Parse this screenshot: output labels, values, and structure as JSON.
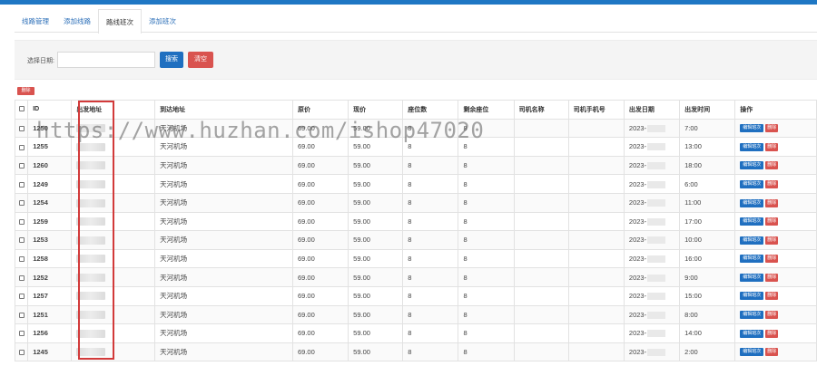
{
  "tabs": [
    {
      "label": "线路管理"
    },
    {
      "label": "添加线路"
    },
    {
      "label": "路线班次"
    },
    {
      "label": "添加班次"
    }
  ],
  "filter": {
    "label": "选择日期:",
    "input_value": "",
    "search_label": "搜索",
    "clear_label": "清空"
  },
  "bulk_delete_label": "删除",
  "table": {
    "headers": [
      "ID",
      "出发地址",
      "到达地址",
      "原价",
      "现价",
      "座位数",
      "剩余座位",
      "司机名称",
      "司机手机号",
      "出发日期",
      "出发时间",
      "操作"
    ],
    "rows": [
      {
        "id": "1250",
        "to": "天河机场",
        "op": "69.00",
        "np": "59.00",
        "seat": "8",
        "rem": "8",
        "date": "2023-",
        "time": "7:00"
      },
      {
        "id": "1255",
        "to": "天河机场",
        "op": "69.00",
        "np": "59.00",
        "seat": "8",
        "rem": "8",
        "date": "2023-",
        "time": "13:00"
      },
      {
        "id": "1260",
        "to": "天河机场",
        "op": "69.00",
        "np": "59.00",
        "seat": "8",
        "rem": "8",
        "date": "2023-",
        "time": "18:00"
      },
      {
        "id": "1249",
        "to": "天河机场",
        "op": "69.00",
        "np": "59.00",
        "seat": "8",
        "rem": "8",
        "date": "2023-",
        "time": "6:00"
      },
      {
        "id": "1254",
        "to": "天河机场",
        "op": "69.00",
        "np": "59.00",
        "seat": "8",
        "rem": "8",
        "date": "2023-",
        "time": "11:00"
      },
      {
        "id": "1259",
        "to": "天河机场",
        "op": "69.00",
        "np": "59.00",
        "seat": "8",
        "rem": "8",
        "date": "2023-",
        "time": "17:00"
      },
      {
        "id": "1253",
        "to": "天河机场",
        "op": "69.00",
        "np": "59.00",
        "seat": "8",
        "rem": "8",
        "date": "2023-",
        "time": "10:00"
      },
      {
        "id": "1258",
        "to": "天河机场",
        "op": "69.00",
        "np": "59.00",
        "seat": "8",
        "rem": "8",
        "date": "2023-",
        "time": "16:00"
      },
      {
        "id": "1252",
        "to": "天河机场",
        "op": "69.00",
        "np": "59.00",
        "seat": "8",
        "rem": "8",
        "date": "2023-",
        "time": "9:00"
      },
      {
        "id": "1257",
        "to": "天河机场",
        "op": "69.00",
        "np": "59.00",
        "seat": "8",
        "rem": "8",
        "date": "2023-",
        "time": "15:00"
      },
      {
        "id": "1251",
        "to": "天河机场",
        "op": "69.00",
        "np": "59.00",
        "seat": "8",
        "rem": "8",
        "date": "2023-",
        "time": "8:00"
      },
      {
        "id": "1256",
        "to": "天河机场",
        "op": "69.00",
        "np": "59.00",
        "seat": "8",
        "rem": "8",
        "date": "2023-",
        "time": "14:00"
      },
      {
        "id": "1245",
        "to": "天河机场",
        "op": "69.00",
        "np": "59.00",
        "seat": "8",
        "rem": "8",
        "date": "2023-",
        "time": "2:00"
      }
    ],
    "edit_label": "编辑班次",
    "delete_label": "删除"
  },
  "watermark": "https://www.huzhan.com/ishop47020",
  "colors": {
    "primary": "#1f6fc0",
    "danger": "#d9534f",
    "highlight": "#d23a3a"
  }
}
